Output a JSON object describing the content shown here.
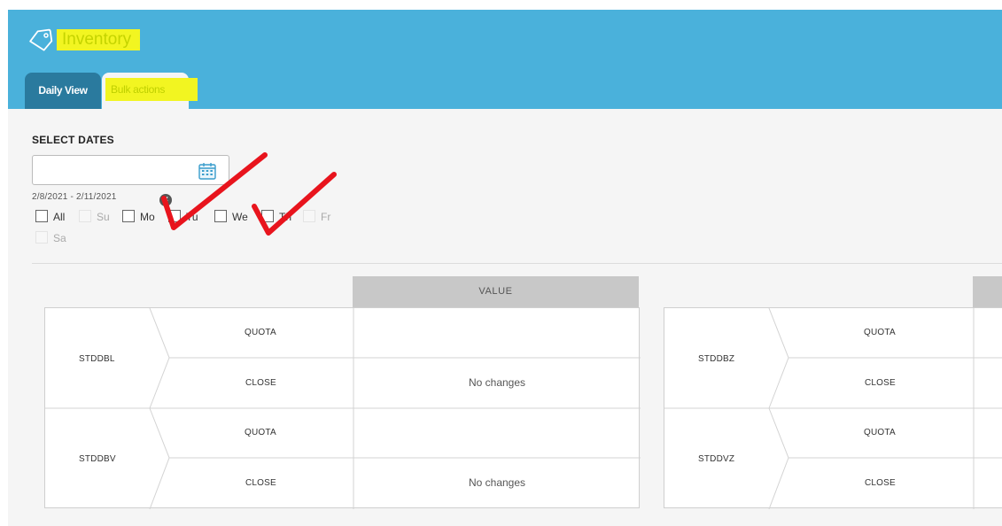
{
  "header": {
    "app_title": "Inventory",
    "tabs": [
      {
        "label": "Daily View",
        "active": false
      },
      {
        "label": "Bulk actions",
        "active": true
      }
    ]
  },
  "date_selector": {
    "label": "SELECT DATES",
    "input_value": "",
    "range": "2/8/2021 - 2/11/2021",
    "days": [
      {
        "label": "All",
        "enabled": true
      },
      {
        "label": "Su",
        "enabled": false
      },
      {
        "label": "Mo",
        "enabled": true
      },
      {
        "label": "Tu",
        "enabled": true
      },
      {
        "label": "We",
        "enabled": true
      },
      {
        "label": "Th",
        "enabled": true
      },
      {
        "label": "Fr",
        "enabled": false
      },
      {
        "label": "Sa",
        "enabled": false
      }
    ]
  },
  "table": {
    "value_header": "VALUE",
    "left_rooms": [
      {
        "room": "STDDBL",
        "rows": [
          {
            "type": "QUOTA",
            "value": ""
          },
          {
            "type": "CLOSE",
            "value": "No changes"
          }
        ]
      },
      {
        "room": "STDDBV",
        "rows": [
          {
            "type": "QUOTA",
            "value": ""
          },
          {
            "type": "CLOSE",
            "value": "No changes"
          }
        ]
      }
    ],
    "right_rooms": [
      {
        "room": "STDDBZ",
        "rows": [
          {
            "type": "QUOTA"
          },
          {
            "type": "CLOSE"
          }
        ]
      },
      {
        "room": "STDDVZ",
        "rows": [
          {
            "type": "QUOTA"
          },
          {
            "type": "CLOSE"
          }
        ]
      }
    ]
  },
  "colors": {
    "header_bg": "#4ab1db",
    "active_tab_bg": "#2a7a9e",
    "highlight": "#f2f521",
    "annotation_check": "#e8141d"
  },
  "icons": [
    "tag-icon",
    "calendar-icon",
    "clear-icon",
    "checkmark-annotation"
  ]
}
